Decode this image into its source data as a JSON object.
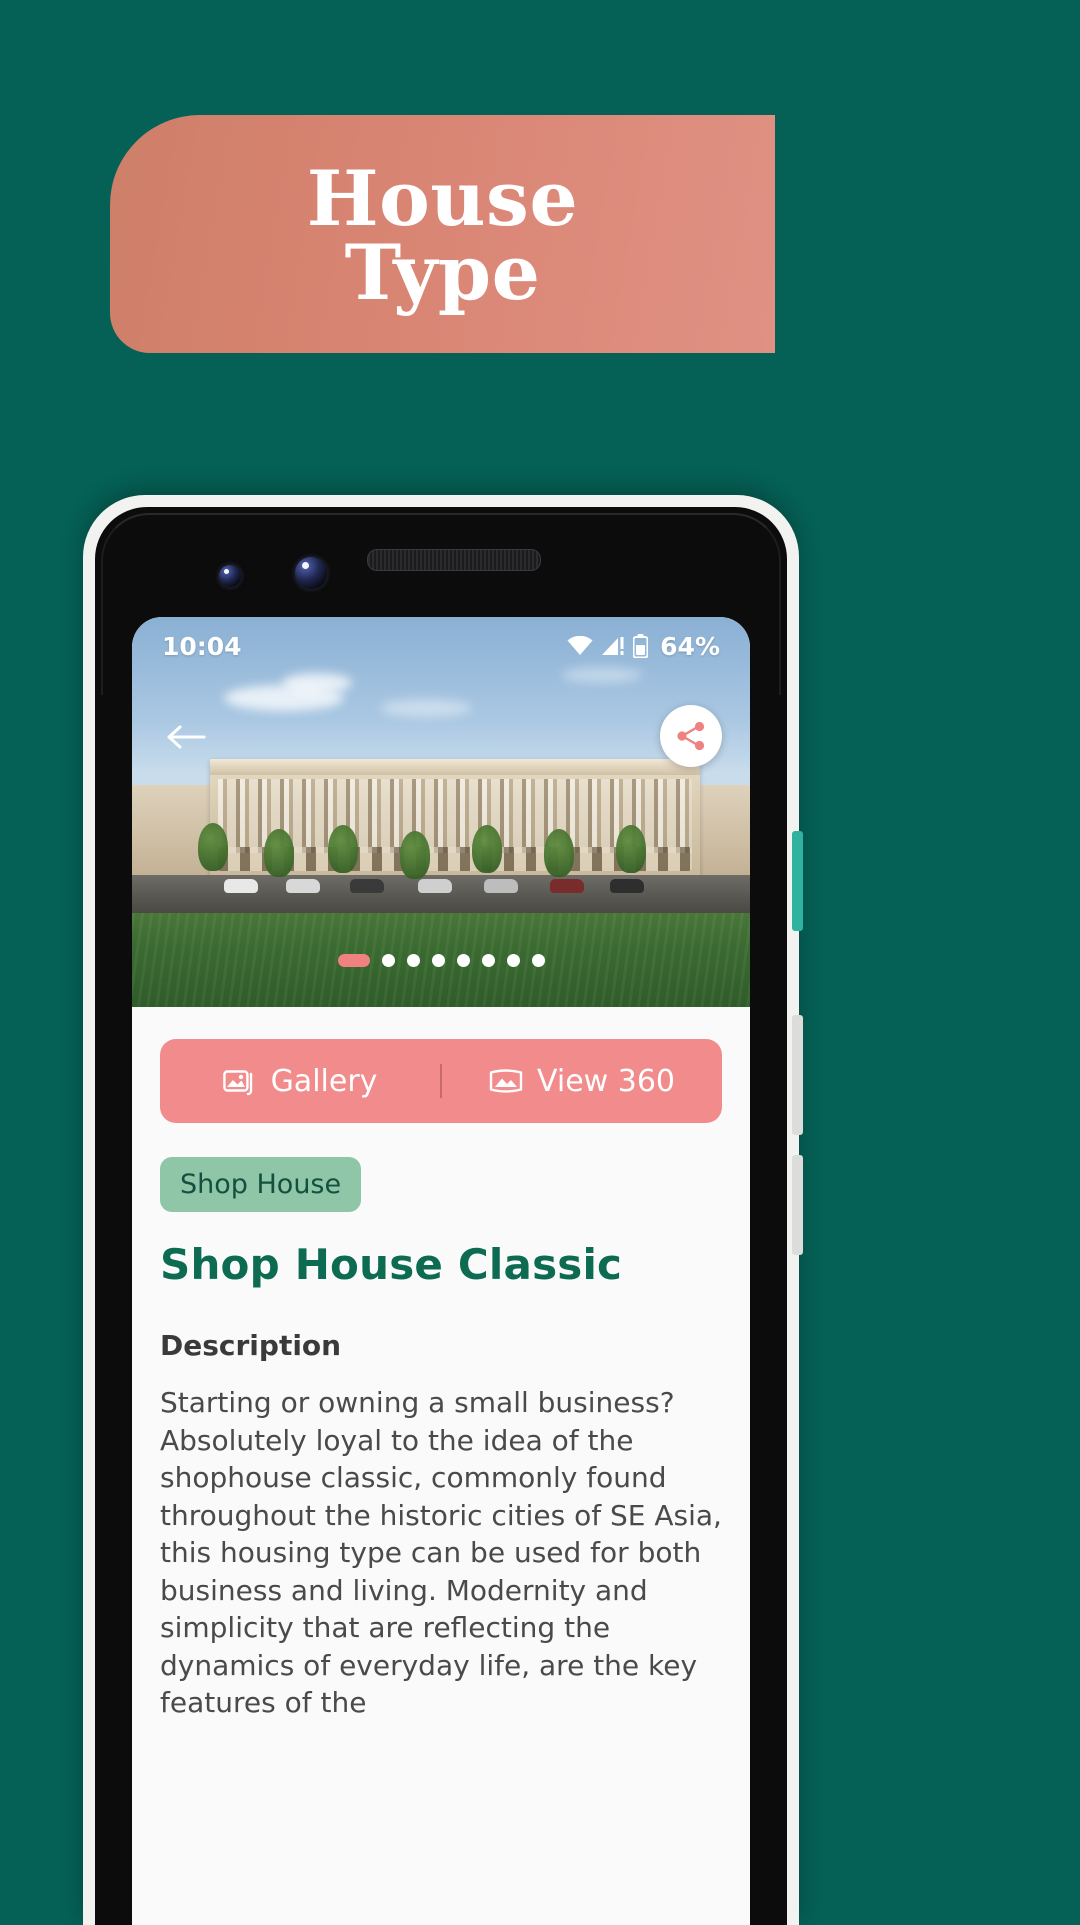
{
  "theme": {
    "background": "#056055",
    "banner_gradient_from": "#ce7f68",
    "banner_gradient_to": "#e09183",
    "accent_pink": "#f28b8b",
    "accent_green": "#8fc6a8",
    "title_teal": "#0d6b52"
  },
  "banner": {
    "title": "House\nType"
  },
  "phone": {
    "status_bar": {
      "time": "10:04",
      "battery_percent": "64%",
      "wifi_icon": "wifi-icon",
      "signal_icon": "signal-icon",
      "battery_icon": "battery-icon"
    },
    "hero": {
      "back_icon": "arrow-left-icon",
      "share_icon": "share-icon",
      "carousel": {
        "total": 8,
        "active_index": 0
      }
    },
    "action_bar": {
      "gallery_label": "Gallery",
      "gallery_icon": "gallery-icon",
      "view360_label": "View 360",
      "view360_icon": "panorama-icon"
    },
    "content": {
      "tag": "Shop House",
      "title": "Shop House Classic",
      "description_label": "Description",
      "description": "Starting or owning a small business? Absolutely loyal to the idea of the shophouse classic, commonly found throughout the historic cities of SE Asia, this housing type can be used for both business and living. Modernity and simplicity that are reflecting the dynamics of everyday life, are the key features of the"
    }
  }
}
